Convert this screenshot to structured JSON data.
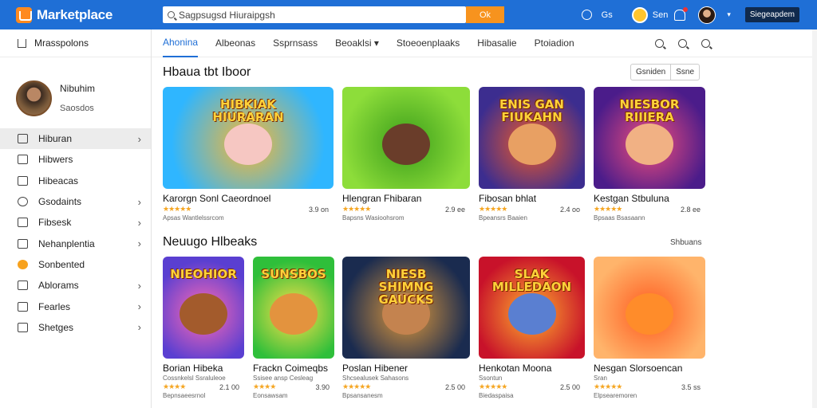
{
  "app": {
    "title": "Marketplace",
    "brand_color": "#1f6fd6",
    "accent_color": "#f7931e"
  },
  "search": {
    "value": "Sagpsugsd Hiuraipgsh",
    "button_label": "Ok"
  },
  "topbar": {
    "lang": "Gs",
    "user_label": "Sen",
    "signin_label": "Siegeapdem"
  },
  "sidebar": {
    "header": "Mrasspolons",
    "profile": {
      "name": "Nibuhim",
      "subtitle": "Saosdos"
    },
    "items": [
      {
        "label": "Hiburan",
        "icon": "store-icon",
        "chevron": true,
        "active": true
      },
      {
        "label": "Hibwers",
        "icon": "grid-icon",
        "chevron": false,
        "active": false
      },
      {
        "label": "Hibeacas",
        "icon": "list-icon",
        "chevron": false,
        "active": false
      },
      {
        "label": "Gsodaints",
        "icon": "compass-icon",
        "chevron": true,
        "active": false
      },
      {
        "label": "Fibsesk",
        "icon": "chart-icon",
        "chevron": true,
        "active": false
      },
      {
        "label": "Nehanplentia",
        "icon": "card-icon",
        "chevron": true,
        "active": false
      },
      {
        "label": "Sonbented",
        "icon": "coin-icon",
        "chevron": false,
        "active": false
      },
      {
        "label": "Ablorams",
        "icon": "bag-icon",
        "chevron": true,
        "active": false
      },
      {
        "label": "Fearles",
        "icon": "book-icon",
        "chevron": true,
        "active": false
      },
      {
        "label": "Shetges",
        "icon": "link-icon",
        "chevron": true,
        "active": false
      }
    ]
  },
  "tabs": [
    {
      "label": "Ahonina",
      "active": true
    },
    {
      "label": "Albeonas",
      "active": false
    },
    {
      "label": "Ssprnsass",
      "active": false
    },
    {
      "label": "Beoaklsi ▾",
      "active": false
    },
    {
      "label": "Stoeoenplaaks",
      "active": false
    },
    {
      "label": "Hibasalie",
      "active": false
    },
    {
      "label": "Ptoiadion",
      "active": false
    }
  ],
  "section1": {
    "title": "Hbaua tbt Iboor",
    "filters": [
      "Gsniden",
      "Ssne"
    ],
    "cards": [
      {
        "title": "Karorgn Sonl Caeordnoel",
        "sub": "",
        "stars": "★★★★★",
        "price": "3.9 on",
        "seller": "Apsas Wantlelssrcom",
        "banner": "HIBKIAK\nHIURARAN",
        "c1": "#2fb6ff",
        "c2": "#f7b733",
        "face": "#f6c7c2"
      },
      {
        "title": "Hlengran Fhibaran",
        "sub": "",
        "stars": "★★★★★",
        "price": "2.9 ee",
        "seller": "Bapsns Wasioohsrom",
        "banner": "",
        "c1": "#8ddd3a",
        "c2": "#3b9e1a",
        "face": "#6a3d2a"
      },
      {
        "title": "Fibosan bhlat",
        "sub": "",
        "stars": "★★★★★",
        "price": "2.4 oo",
        "seller": "Bpeansrs Baaien",
        "banner": "ENIS GAN\nFIUKAHN",
        "c1": "#3c2d8f",
        "c2": "#f05a28",
        "face": "#e8a063"
      },
      {
        "title": "Kestgan Stbuluna",
        "sub": "",
        "stars": "★★★★★",
        "price": "2.8 ee",
        "seller": "Bpsaas Bsasaann",
        "banner": "NIESBOR\nRIIIERA",
        "c1": "#4b1c8a",
        "c2": "#f04d7c",
        "face": "#f1b184"
      }
    ]
  },
  "section2": {
    "title": "Neuugo Hlbeaks",
    "see_all": "Shbuans",
    "cards": [
      {
        "title": "Borian Hibeka",
        "sub": "Cossnkelsl Ssraluleoe",
        "stars": "★★★★",
        "price": "2.1 00",
        "seller": "Bepnsaeesrnol",
        "banner": "NIEOHIOR",
        "c1": "#5a3fd1",
        "c2": "#ff6ab4",
        "face": "#a35b2c"
      },
      {
        "title": "Frackn Coimeqbs",
        "sub": "Ssisee ansp Cesleag",
        "stars": "★★★★",
        "price": "3.90",
        "seller": "Eonsawsam",
        "banner": "SUNSBOS",
        "c1": "#2fbf3a",
        "c2": "#ffe04a",
        "face": "#e3933e"
      },
      {
        "title": "Poslan Hibener",
        "sub": "Shcsealusek Sahasons",
        "stars": "★★★★★",
        "price": "2.5 00",
        "seller": "Bpsansanesm",
        "banner": "NIESB\nSHIMNG\nGAUCKS",
        "c1": "#1a2b4f",
        "c2": "#e09a3c",
        "face": "#c4834f"
      },
      {
        "title": "Henkotan Moona",
        "sub": "Ssontun",
        "stars": "★★★★★",
        "price": "2.5 00",
        "seller": "Biedaspaisa",
        "banner": "SLAK\nMILLEDAON",
        "c1": "#c8122a",
        "c2": "#ffb02e",
        "face": "#5a7fd1"
      },
      {
        "title": "Nesgan Slorsoencan",
        "sub": "Sran",
        "stars": "★★★★★",
        "price": "3.5 ss",
        "seller": "Elpsearemoren",
        "banner": "",
        "c1": "#ffb46b",
        "c2": "#ff5a1e",
        "face": "#ff8c2a"
      }
    ]
  }
}
